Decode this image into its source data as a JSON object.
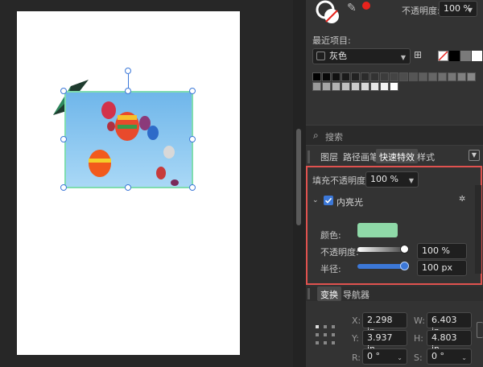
{
  "top": {
    "opacity_label": "不透明度:",
    "opacity_value": "100 %"
  },
  "recent": {
    "label": "最近项目:",
    "palette_name": "灰色"
  },
  "search": {
    "placeholder": "搜索"
  },
  "tabs": {
    "layers": "图层",
    "path_brush": "路径画笔",
    "quick_effects": "快速特效",
    "styles": "样式"
  },
  "effects": {
    "fill_opacity_label": "填充不透明度:",
    "fill_opacity_value": "100 %",
    "inner_glow_label": "内亮光",
    "inner_glow_enabled": true,
    "color_label": "颜色:",
    "glow_color": "#8fd9a8",
    "opacity_label": "不透明度:",
    "opacity_value": "100 %",
    "radius_label": "半径:",
    "radius_value": "100 px",
    "opacity_level": 1.0,
    "radius_level": 1.0
  },
  "transform_tabs": {
    "transform": "变换",
    "navigator": "导航器"
  },
  "transform": {
    "x_label": "X:",
    "x_value": "2.298 in",
    "y_label": "Y:",
    "y_value": "3.937 in",
    "w_label": "W:",
    "w_value": "6.403 in",
    "h_label": "H:",
    "h_value": "4.803 in",
    "r_label": "R:",
    "r_value": "0 °",
    "s_label": "S:",
    "s_value": "0 °"
  },
  "colors": {
    "accent": "#3c78d8",
    "highlight_border": "#e0524f",
    "selection_stroke": "#7fdcb0",
    "fill_red": "#e8231d"
  }
}
